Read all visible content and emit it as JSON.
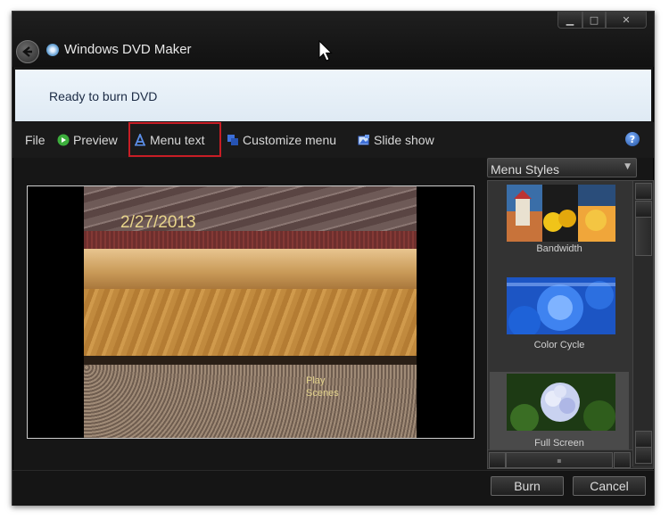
{
  "window": {
    "title": "Windows DVD Maker",
    "caption_buttons": {
      "minimize": "▁",
      "maximize": "□",
      "close": "✕"
    }
  },
  "status": {
    "text": "Ready to burn DVD"
  },
  "toolbar": {
    "file": "File",
    "preview": "Preview",
    "menu_text": "Menu text",
    "customize_menu": "Customize menu",
    "slide_show": "Slide show",
    "help_glyph": "?"
  },
  "preview": {
    "date": "2/27/2013",
    "play": "Play",
    "scenes": "Scenes"
  },
  "menu_styles": {
    "dropdown_label": "Menu Styles",
    "items": [
      {
        "label": "Bandwidth",
        "selected": false
      },
      {
        "label": "Color Cycle",
        "selected": false
      },
      {
        "label": "Full Screen",
        "selected": true
      }
    ]
  },
  "buttons": {
    "burn": "Burn",
    "cancel": "Cancel"
  },
  "colors": {
    "highlight_border": "#c81d25",
    "status_background": "#e6f0f8",
    "window_background": "#161616"
  }
}
